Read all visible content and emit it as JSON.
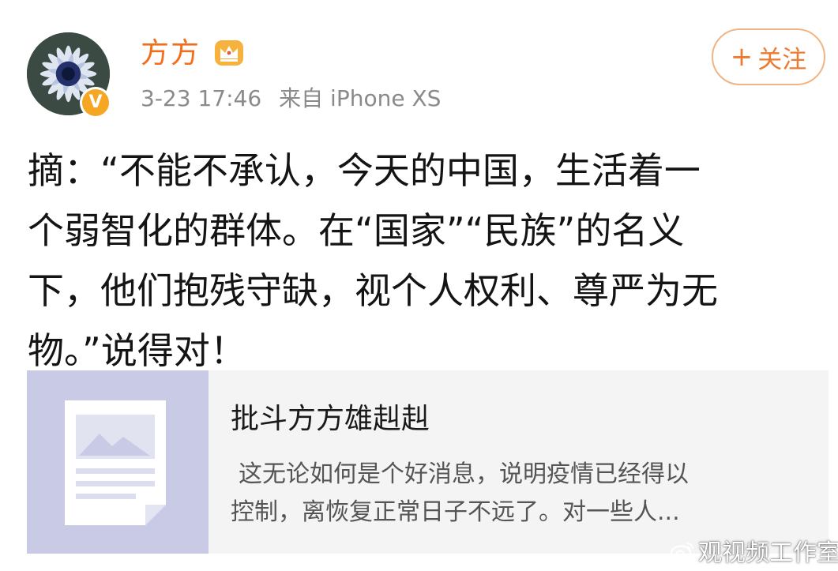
{
  "author": {
    "name": "方方",
    "avatar_icon": "flower-avatar",
    "verified_badge": "V",
    "member_icon": "crown-icon"
  },
  "post_meta": {
    "time": "3-23 17:46",
    "source": "来自 iPhone XS"
  },
  "follow_button": {
    "plus": "+",
    "label": "关注"
  },
  "post": {
    "lines": [
      "摘：“不能不承认，今天的中国，生活着一",
      "个弱智化的群体。在“国家”“民族”的名义",
      "下，他们抱残守缺，视个人权利、尊严为无",
      "物。”说得对！"
    ]
  },
  "link_card": {
    "thumb_icon": "article-placeholder-icon",
    "title": "批斗方方雄赳赳",
    "description_lines": [
      "这无论如何是个好消息，说明疫情已经得以",
      "控制，离恢复正常日子不远了。对一些人..."
    ]
  },
  "watermark": {
    "icon": "weibo-icon",
    "text": "观视频工作室"
  },
  "colors": {
    "username": "#f46d1b",
    "meta_text": "#8a8a8a",
    "follow_border": "#f2b482",
    "follow_text": "#ee7a2f",
    "card_background": "#f4f4f4",
    "thumb_background": "#c9cbe6",
    "badge": "#f5a623"
  }
}
